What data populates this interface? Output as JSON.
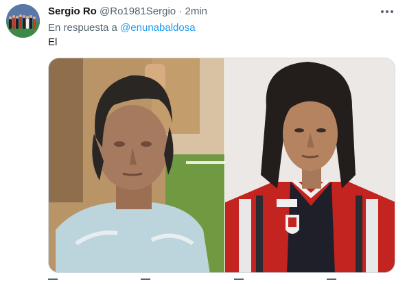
{
  "tweet": {
    "author_name": "Sergio Ro",
    "author_handle": "@Ro1981Sergio",
    "separator": "·",
    "time": "2min",
    "reply_prefix": "En respuesta a",
    "reply_to": "@enunabaldosa",
    "text": "El"
  },
  "media": {
    "image_count": 2,
    "images": [
      "statue-bust-photo",
      "footballer-portrait-photo"
    ]
  },
  "icons": {
    "more": "more-horizontal-icon",
    "actions": [
      "reply-icon",
      "retweet-icon",
      "like-icon",
      "share-icon"
    ]
  },
  "colors": {
    "text_primary": "#0f1419",
    "text_secondary": "#536471",
    "link": "#1d9bf0",
    "border": "#cfd9de"
  }
}
